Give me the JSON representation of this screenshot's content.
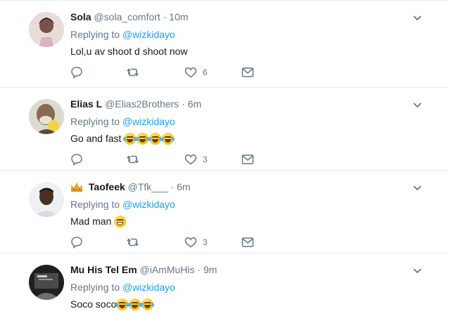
{
  "tweets": [
    {
      "name": "Sola",
      "handle": "@sola_comfort",
      "separator": "·",
      "time": "10m",
      "replying_prefix": "Replying to",
      "replying_to": "@wizkidayo",
      "text": "Lol,u av shoot d shoot now",
      "emoji_count": 0,
      "like_count": "6",
      "avatar_colors": [
        "#d9c7c2",
        "#6b4a44"
      ]
    },
    {
      "name": "Elias L",
      "handle": "@Elias2Brothers",
      "separator": "·",
      "time": "6m",
      "replying_prefix": "Replying to",
      "replying_to": "@wizkidayo",
      "text": "Go and fast",
      "emoji_count": 4,
      "emoji": "face-with-tears-of-joy",
      "like_count": "3",
      "avatar_colors": [
        "#cfc9b8",
        "#5a4b3a"
      ]
    },
    {
      "name": "Taofeek",
      "name_badge": "crown-icon",
      "handle": "@Tfk___",
      "separator": "·",
      "time": "6m",
      "replying_prefix": "Replying to",
      "replying_to": "@wizkidayo",
      "text": "Mad man",
      "emoji_count": 1,
      "emoji": "grinning-face",
      "like_count": "3",
      "avatar_colors": [
        "#e8ecef",
        "#3b2a22"
      ]
    },
    {
      "name": "Mu His Tel Em",
      "handle": "@iAmMuHis",
      "separator": "·",
      "time": "9m",
      "replying_prefix": "Replying to",
      "replying_to": "@wizkidayo",
      "text": "Soco soco",
      "emoji_count": 3,
      "emoji": "face-with-tears-of-joy",
      "like_count": "",
      "avatar_colors": [
        "#2b2b2b",
        "#bdbdbd"
      ]
    }
  ],
  "colors": {
    "text": "#14171a",
    "secondary": "#657786",
    "link": "#1da1f2",
    "divider": "#e6ecf0"
  }
}
